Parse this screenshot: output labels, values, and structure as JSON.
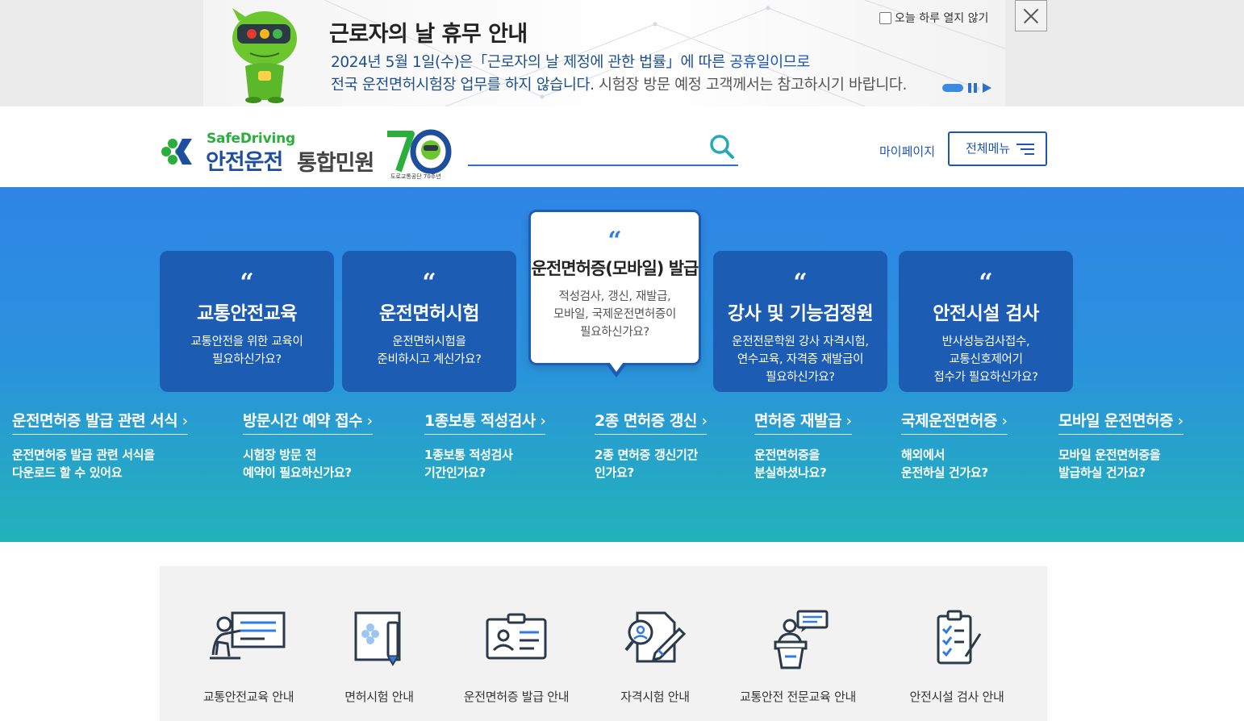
{
  "notice": {
    "title": "근로자의 날 휴무 안내",
    "line1_part1": "2024년 5월 1일(수)은「근로자의 날 제정에 관한 법률」에 따른 ",
    "line1_part2": "공휴일이므로",
    "line2_part1": "전국 운전면허시험장 업무를 하지 않습니다.",
    "line2_part2": " 시험장 방문 예정 고객께서는 참고하시기 바랍니다.",
    "dont_show_today": "오늘 하루 열지 않기",
    "close_icon": "close-icon"
  },
  "header": {
    "logo_small": "SafeDriving",
    "logo_main": "안전운전",
    "logo_sub": "통합민원",
    "logo_70_caption": "도로교통공단 70주년",
    "search_placeholder": "",
    "mypage": "마이페이지",
    "allmenu": "전체메뉴"
  },
  "cards": [
    {
      "title": "교통안전교육",
      "desc1": "교통안전을 위한 교육이",
      "desc2": "필요하신가요?",
      "desc3": ""
    },
    {
      "title": "운전면허시험",
      "desc1": "운전면허시험을",
      "desc2": "준비하시고 계신가요?",
      "desc3": ""
    },
    {
      "title": "운전면허증(모바일) 발급",
      "desc1": "적성검사, 갱신, 재발급,",
      "desc2": "모바일, 국제운전면허증이",
      "desc3": "필요하신가요?"
    },
    {
      "title": "강사 및 기능검정원",
      "desc1": "운전전문학원 강사 자격시험,",
      "desc2": "연수교육, 자격증 재발급이",
      "desc3": "필요하신가요?"
    },
    {
      "title": "안전시설 검사",
      "desc1": "반사성능검사접수,",
      "desc2": "교통신호제어기",
      "desc3": "접수가 필요하신가요?"
    }
  ],
  "quick_links": [
    {
      "title": "운전면허증 발급 관련 서식",
      "desc1": "운전면허증 발급 관련 서식을",
      "desc2": "다운로드 할 수 있어요"
    },
    {
      "title": "방문시간 예약 접수",
      "desc1": "시험장 방문 전",
      "desc2": "예약이 필요하신가요?"
    },
    {
      "title": "1종보통 적성검사",
      "desc1": "1종보통 적성검사",
      "desc2": "기간인가요?"
    },
    {
      "title": "2종 면허증 갱신",
      "desc1": "2종 면허증 갱신기간",
      "desc2": "인가요?"
    },
    {
      "title": "면허증 재발급",
      "desc1": "운전면허증을",
      "desc2": "분실하셨나요?"
    },
    {
      "title": "국제운전면허증",
      "desc1": "해외에서",
      "desc2": "운전하실 건가요?"
    },
    {
      "title": "모바일 운전면허증",
      "desc1": "모바일 운전면허증을",
      "desc2": "발급하실 건가요?"
    }
  ],
  "guides": [
    {
      "label": "교통안전교육 안내",
      "icon": "presentation-icon"
    },
    {
      "label": "면허시험 안내",
      "icon": "license-test-icon"
    },
    {
      "label": "운전면허증 발급 안내",
      "icon": "id-card-icon"
    },
    {
      "label": "자격시험 안내",
      "icon": "qualification-exam-icon"
    },
    {
      "label": "교통안전 전문교육 안내",
      "icon": "lecture-podium-icon"
    },
    {
      "label": "안전시설 검사 안내",
      "icon": "checklist-icon"
    }
  ],
  "colors": {
    "brand_blue": "#1f55b3",
    "card_blue": "#1c5db3",
    "hero_top": "#2f85e6",
    "hero_bottom": "#22b3b9",
    "logo_green": "#2cae3c"
  }
}
